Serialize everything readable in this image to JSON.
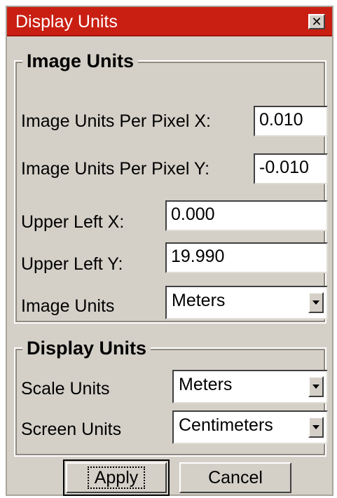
{
  "window": {
    "title": "Display Units",
    "close_symbol": "✕"
  },
  "image_units_group": {
    "title": "Image Units",
    "fields": {
      "per_pixel_x": {
        "label": "Image Units Per Pixel X:",
        "value": "0.010"
      },
      "per_pixel_y": {
        "label": "Image Units Per Pixel Y:",
        "value": "-0.010"
      },
      "upper_left_x": {
        "label": "Upper Left X:",
        "value": "0.000"
      },
      "upper_left_y": {
        "label": "Upper Left Y:",
        "value": "19.990"
      },
      "image_units": {
        "label": "Image Units",
        "selected": "Meters"
      }
    }
  },
  "display_units_group": {
    "title": "Display Units",
    "fields": {
      "scale_units": {
        "label": "Scale Units",
        "selected": "Meters"
      },
      "screen_units": {
        "label": "Screen Units",
        "selected": "Centimeters"
      }
    }
  },
  "buttons": {
    "apply": "Apply",
    "cancel": "Cancel"
  },
  "colors": {
    "titlebar": "#c91f12",
    "dialog_background": "#d4d0c8"
  }
}
